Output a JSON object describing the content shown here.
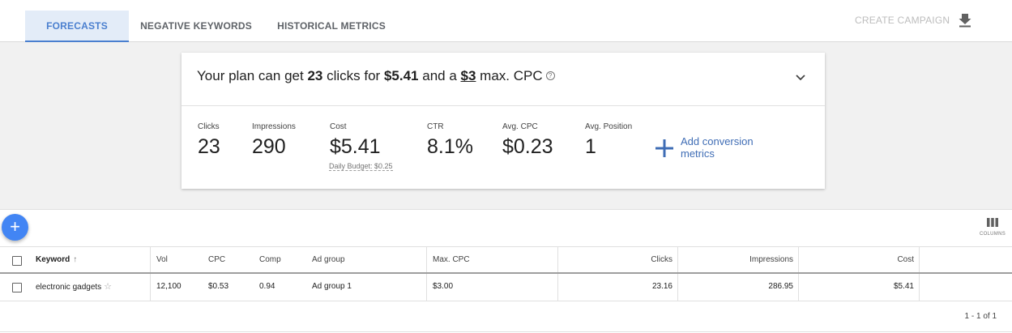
{
  "tabs": [
    {
      "label": "FORECASTS",
      "active": true
    },
    {
      "label": "NEGATIVE KEYWORDS",
      "active": false
    },
    {
      "label": "HISTORICAL METRICS",
      "active": false
    }
  ],
  "toolbar": {
    "create_campaign": "CREATE CAMPAIGN",
    "download_icon": "download-icon"
  },
  "summary": {
    "prefix": "Your plan can get",
    "clicks": "23",
    "mid1": "clicks for",
    "cost": "$5.41",
    "mid2": "and a",
    "max_cpc": "$3",
    "suffix": "max. CPC",
    "help_glyph": "?"
  },
  "metrics": {
    "clicks": {
      "label": "Clicks",
      "value": "23"
    },
    "impressions": {
      "label": "Impressions",
      "value": "290"
    },
    "cost": {
      "label": "Cost",
      "value": "$5.41"
    },
    "ctr": {
      "label": "CTR",
      "value": "8.1%"
    },
    "avg_cpc": {
      "label": "Avg. CPC",
      "value": "$0.23"
    },
    "avg_position": {
      "label": "Avg. Position",
      "value": "1"
    },
    "daily_budget": "Daily Budget: $0.25",
    "add_conversion": "Add conversion metrics"
  },
  "table": {
    "fab": "+",
    "columns_label": "COLUMNS",
    "headers": {
      "keyword": "Keyword",
      "vol": "Vol",
      "cpc": "CPC",
      "comp": "Comp",
      "ad_group": "Ad group",
      "max_cpc": "Max. CPC",
      "clicks": "Clicks",
      "impressions": "Impressions",
      "cost": "Cost"
    },
    "sort_glyph": "↑",
    "rows": [
      {
        "keyword": "electronic gadgets",
        "star": "☆",
        "vol": "12,100",
        "cpc": "$0.53",
        "comp": "0.94",
        "ad_group": "Ad group 1",
        "max_cpc": "$3.00",
        "clicks": "23.16",
        "impressions": "286.95",
        "cost": "$5.41"
      }
    ],
    "pagination": "1 - 1 of 1"
  },
  "colors": {
    "accent": "#4a7fcf",
    "fab": "#4285f4",
    "link": "#3f6db5"
  }
}
